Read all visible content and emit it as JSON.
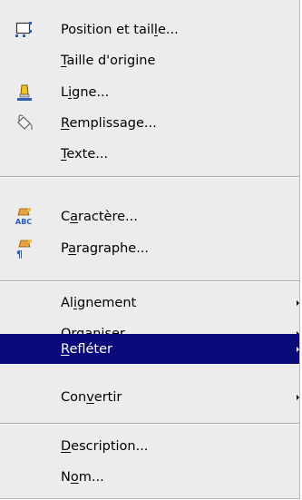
{
  "colors": {
    "menu_background": "#ececec",
    "selection_background": "#0a0a7a",
    "selection_text": "#ffffff"
  },
  "menu": {
    "items": [
      {
        "id": "position",
        "pre": "Position et tail",
        "key": "l",
        "post": "e...",
        "icon": "position-size-icon",
        "submenu": false
      },
      {
        "id": "original-size",
        "pre": "",
        "key": "T",
        "post": "aille d'origine",
        "icon": null,
        "submenu": false
      },
      {
        "id": "line",
        "pre": "L",
        "key": "i",
        "post": "gne...",
        "icon": "line-pen-icon",
        "submenu": false
      },
      {
        "id": "area",
        "pre": "",
        "key": "R",
        "post": "emplissage...",
        "icon": "fill-bucket-icon",
        "submenu": false
      },
      {
        "id": "text",
        "pre": "",
        "key": "T",
        "post": "exte...",
        "icon": null,
        "submenu": false
      },
      {
        "id": "character",
        "pre": "C",
        "key": "a",
        "post": "ractère...",
        "icon": "character-abc-icon",
        "submenu": false
      },
      {
        "id": "paragraph",
        "pre": "P",
        "key": "a",
        "post": "ragraphe...",
        "icon": "paragraph-icon",
        "submenu": false
      },
      {
        "id": "alignment",
        "pre": "Al",
        "key": "i",
        "post": "gnement",
        "icon": null,
        "submenu": true
      },
      {
        "id": "arrange",
        "pre": "Orga",
        "key": "n",
        "post": "iser",
        "icon": null,
        "submenu": true
      },
      {
        "id": "flip",
        "pre": "",
        "key": "R",
        "post": "efléter",
        "icon": null,
        "submenu": true,
        "selected": true
      },
      {
        "id": "convert",
        "pre": "Con",
        "key": "v",
        "post": "ertir",
        "icon": null,
        "submenu": true
      },
      {
        "id": "description",
        "pre": "",
        "key": "D",
        "post": "escription...",
        "icon": null,
        "submenu": false
      },
      {
        "id": "name",
        "pre": "N",
        "key": "o",
        "post": "m...",
        "icon": null,
        "submenu": false
      }
    ]
  }
}
